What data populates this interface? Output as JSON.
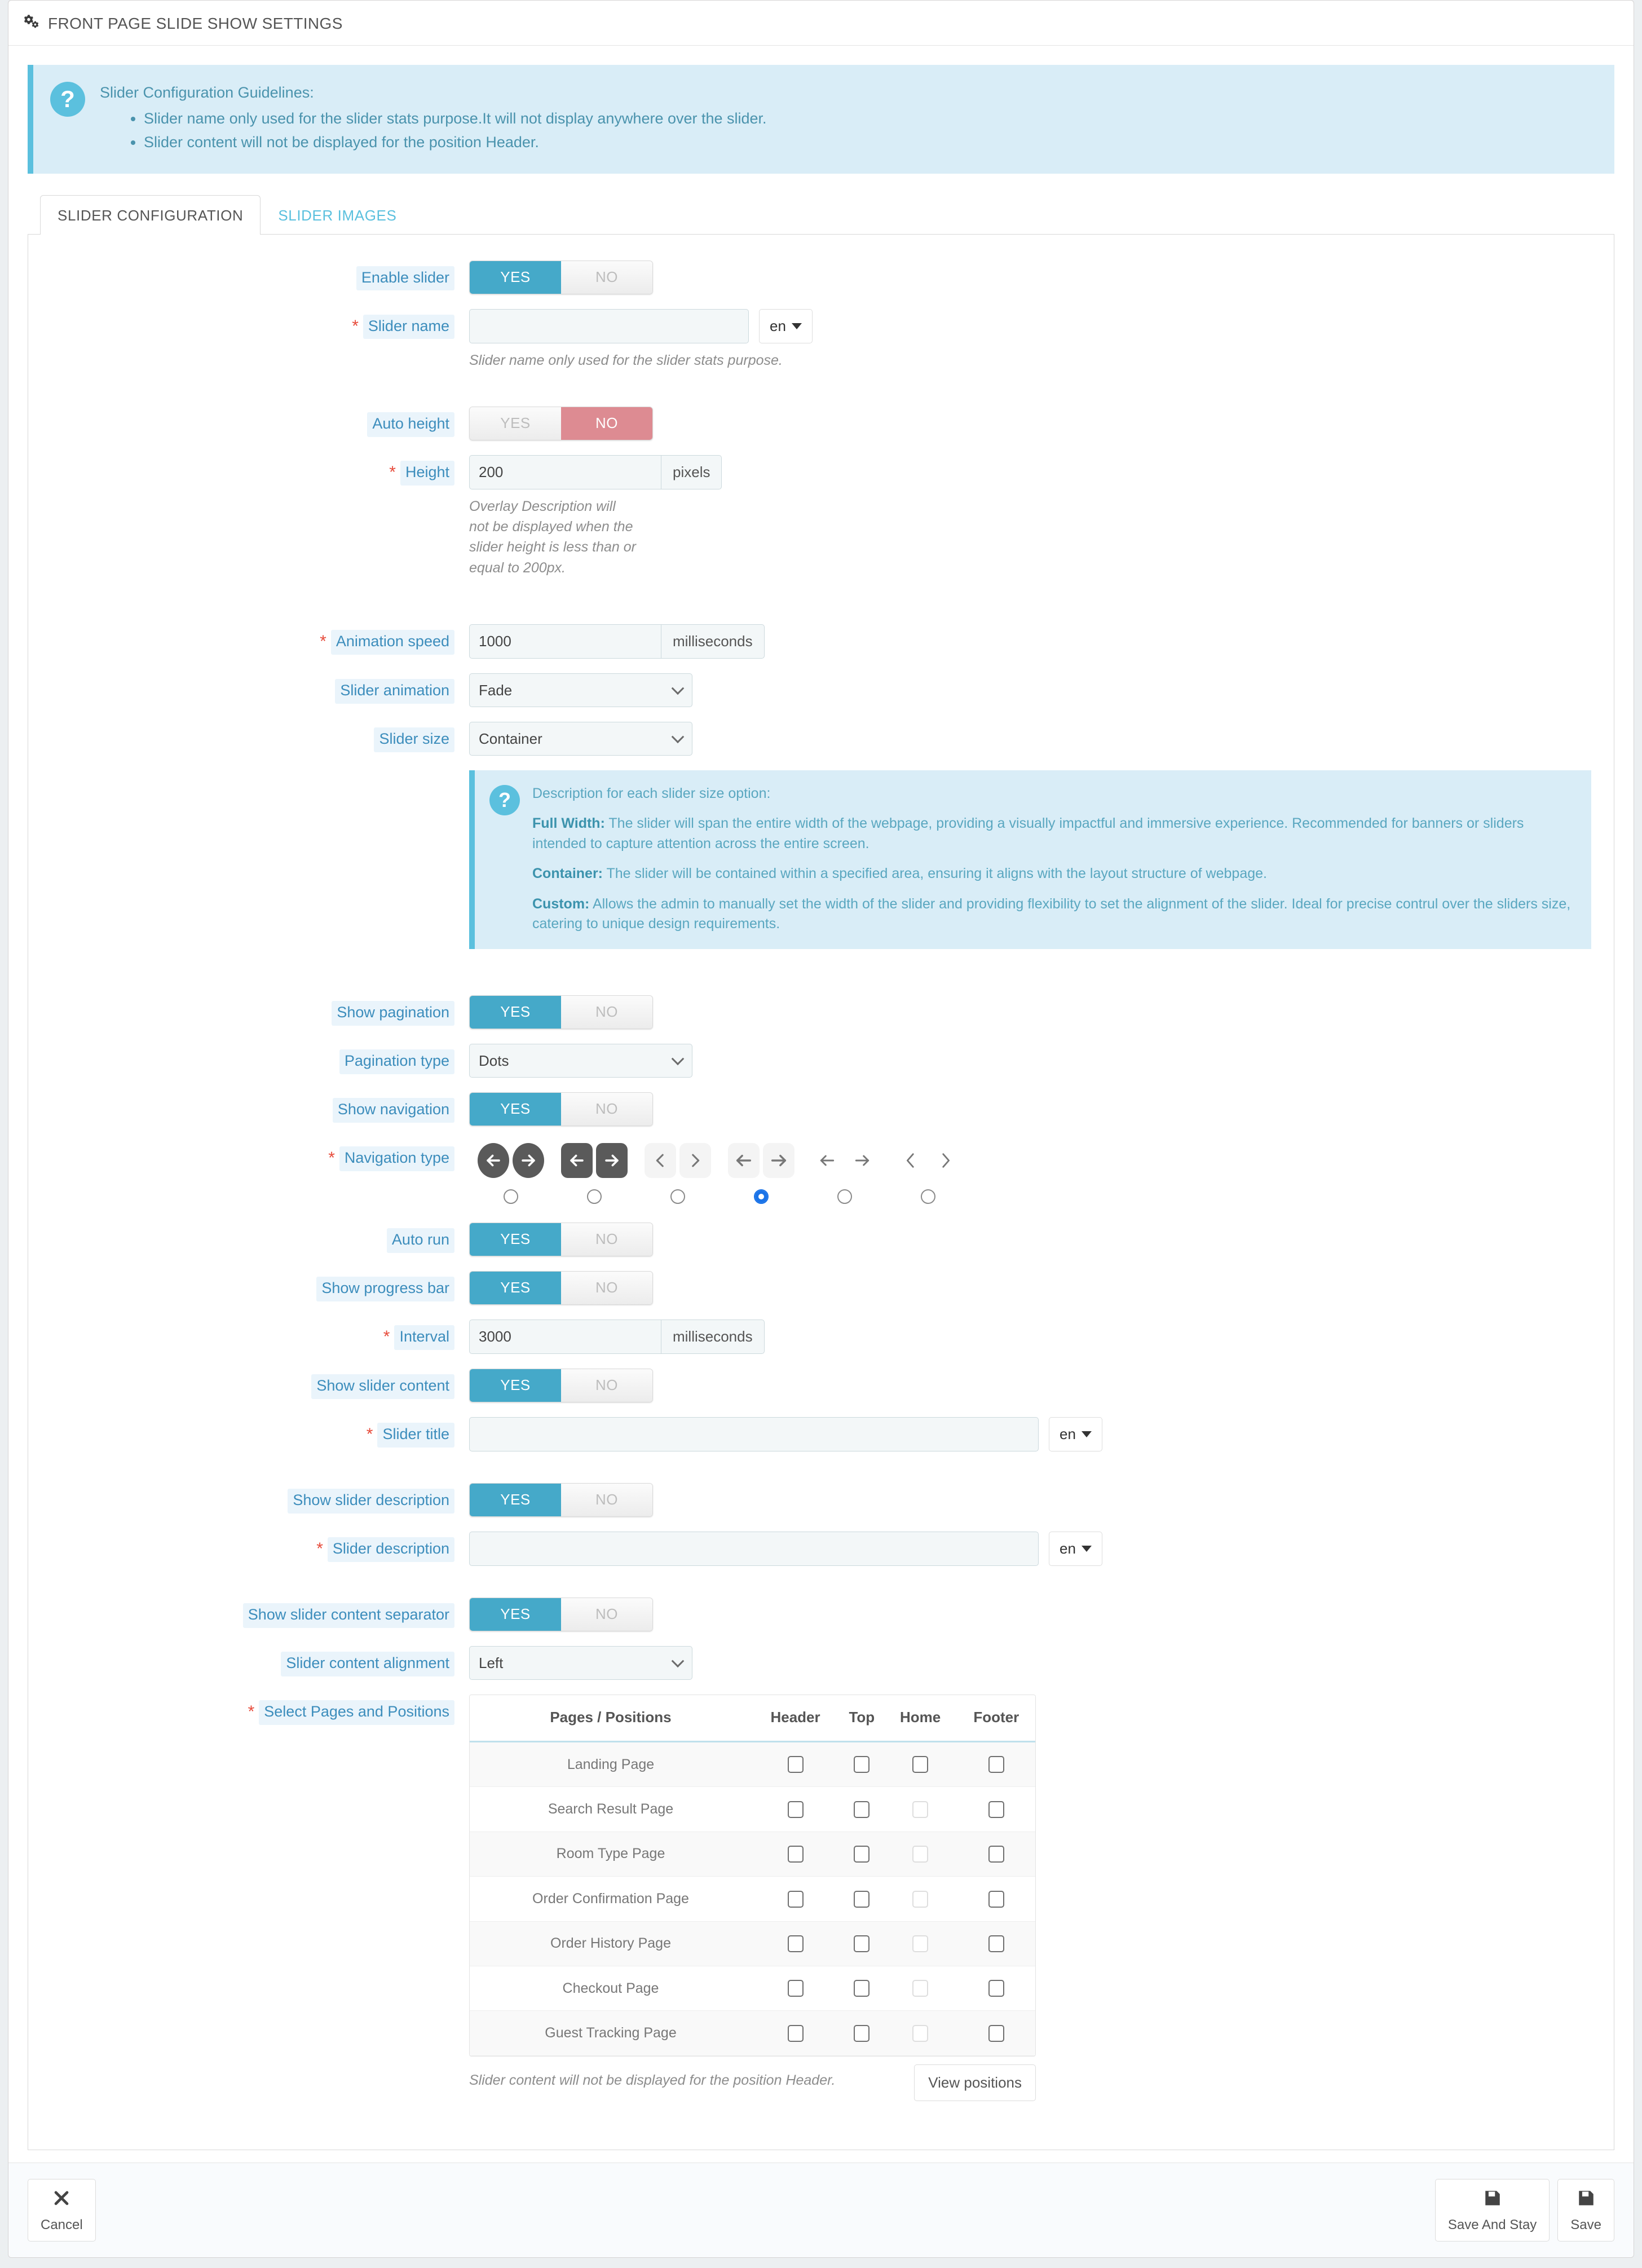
{
  "header": {
    "title": "FRONT PAGE SLIDE SHOW SETTINGS",
    "icon": "gears-icon"
  },
  "guidelines_alert": {
    "icon": "question-circle-icon",
    "title": "Slider Configuration Guidelines:",
    "items": [
      "Slider name only used for the slider stats purpose.It will not display anywhere over the slider.",
      "Slider content will not be displayed for the position Header."
    ]
  },
  "tabs": [
    {
      "label": "SLIDER CONFIGURATION",
      "active": true
    },
    {
      "label": "SLIDER IMAGES",
      "active": false
    }
  ],
  "form": {
    "enable_slider": {
      "label": "Enable slider",
      "yes": "YES",
      "no": "NO",
      "value": "YES"
    },
    "slider_name": {
      "label": "Slider name",
      "required": "*",
      "value": "",
      "lang": "en",
      "help": "Slider name only used for the slider stats purpose."
    },
    "auto_height": {
      "label": "Auto height",
      "yes": "YES",
      "no": "NO",
      "value": "NO"
    },
    "height": {
      "label": "Height",
      "required": "*",
      "value": "200",
      "unit": "pixels",
      "help": "Overlay Description will not be displayed when the slider height is less than or equal to 200px."
    },
    "animation_speed": {
      "label": "Animation speed",
      "required": "*",
      "value": "1000",
      "unit": "milliseconds"
    },
    "slider_animation": {
      "label": "Slider animation",
      "value": "Fade",
      "options": [
        "Fade"
      ]
    },
    "slider_size": {
      "label": "Slider size",
      "value": "Container",
      "options": [
        "Container"
      ]
    },
    "show_pagination": {
      "label": "Show pagination",
      "yes": "YES",
      "no": "NO",
      "value": "YES"
    },
    "pagination_type": {
      "label": "Pagination type",
      "value": "Dots",
      "options": [
        "Dots"
      ]
    },
    "show_navigation": {
      "label": "Show navigation",
      "yes": "YES",
      "no": "NO",
      "value": "YES"
    },
    "navigation_type": {
      "label": "Navigation type",
      "required": "*",
      "selected_index": 3
    },
    "auto_run": {
      "label": "Auto run",
      "yes": "YES",
      "no": "NO",
      "value": "YES"
    },
    "show_progress_bar": {
      "label": "Show progress bar",
      "yes": "YES",
      "no": "NO",
      "value": "YES"
    },
    "interval": {
      "label": "Interval",
      "required": "*",
      "value": "3000",
      "unit": "milliseconds"
    },
    "show_slider_content": {
      "label": "Show slider content",
      "yes": "YES",
      "no": "NO",
      "value": "YES"
    },
    "slider_title": {
      "label": "Slider title",
      "required": "*",
      "value": "",
      "lang": "en"
    },
    "show_slider_description": {
      "label": "Show slider description",
      "yes": "YES",
      "no": "NO",
      "value": "YES"
    },
    "slider_description": {
      "label": "Slider description",
      "required": "*",
      "value": "",
      "lang": "en"
    },
    "show_slider_content_separator": {
      "label": "Show slider content separator",
      "yes": "YES",
      "no": "NO",
      "value": "YES"
    },
    "slider_content_alignment": {
      "label": "Slider content alignment",
      "value": "Left",
      "options": [
        "Left"
      ]
    },
    "select_pages_positions": {
      "label": "Select Pages and Positions",
      "required": "*"
    }
  },
  "size_alert": {
    "icon": "question-circle-icon",
    "intro": "Description for each slider size option:",
    "items": [
      {
        "term": "Full Width:",
        "desc": " The slider will span the entire width of the webpage, providing a visually impactful and immersive experience. Recommended for banners or sliders intended to capture attention across the entire screen."
      },
      {
        "term": "Container:",
        "desc": " The slider will be contained within a specified area, ensuring it aligns with the layout structure of webpage."
      },
      {
        "term": "Custom:",
        "desc": " Allows the admin to manually set the width of the slider and providing flexibility to set the alignment of the slider. Ideal for precise contrul over the sliders size, catering to unique design requirements."
      }
    ]
  },
  "positions_table": {
    "columns": [
      "Pages / Positions",
      "Header",
      "Top",
      "Home",
      "Footer"
    ],
    "rows": [
      {
        "page": "Landing Page",
        "header": false,
        "top": false,
        "home": false,
        "footer": false,
        "home_disabled": false
      },
      {
        "page": "Search Result Page",
        "header": false,
        "top": false,
        "home": false,
        "footer": false,
        "home_disabled": true
      },
      {
        "page": "Room Type Page",
        "header": false,
        "top": false,
        "home": false,
        "footer": false,
        "home_disabled": true
      },
      {
        "page": "Order Confirmation Page",
        "header": false,
        "top": false,
        "home": false,
        "footer": false,
        "home_disabled": true
      },
      {
        "page": "Order History Page",
        "header": false,
        "top": false,
        "home": false,
        "footer": false,
        "home_disabled": true
      },
      {
        "page": "Checkout Page",
        "header": false,
        "top": false,
        "home": false,
        "footer": false,
        "home_disabled": true
      },
      {
        "page": "Guest Tracking Page",
        "header": false,
        "top": false,
        "home": false,
        "footer": false,
        "home_disabled": true
      }
    ],
    "note": "Slider content will not be displayed for the position Header.",
    "view_positions_label": "View positions"
  },
  "footer": {
    "cancel": {
      "label": "Cancel",
      "icon": "close-x-icon"
    },
    "save_and_stay": {
      "label": "Save And Stay",
      "icon": "floppy-disk-icon"
    },
    "save": {
      "label": "Save",
      "icon": "floppy-disk-icon"
    }
  },
  "colors": {
    "accent_blue": "#45a9c9",
    "danger_red": "#dd8b92",
    "info_bg": "#d9edf7",
    "info_border": "#5bc0de",
    "label_text": "#3c8dbc",
    "radio_selected": "#1a73e8"
  }
}
